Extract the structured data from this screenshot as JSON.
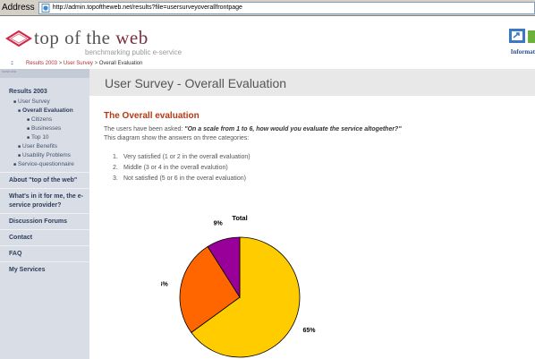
{
  "address_bar": {
    "label": "Address",
    "url": "http://admin.topoftheweb.net/results?file=usersurveyoverallfrontpage"
  },
  "header": {
    "logo_title_a": "top of the ",
    "logo_title_b": "web",
    "logo_subtitle": "benchmarking public e-service",
    "partner_label": "Informat"
  },
  "breadcrumb": {
    "items": [
      "Results 2003",
      "User Survey"
    ],
    "separator": ">",
    "current": "Overall Evaluation"
  },
  "sidebar": {
    "top_strip": "www.vba",
    "section_title": "Results 2003",
    "tree": [
      {
        "label": "User Survey",
        "level": 1
      },
      {
        "label": "Overall Evaluation",
        "level": 2
      },
      {
        "label": "Citizens",
        "level": 3
      },
      {
        "label": "Businesses",
        "level": 3
      },
      {
        "label": "Top 10",
        "level": 3
      },
      {
        "label": "User Benefits",
        "level": 1
      },
      {
        "label": "Usability Problems",
        "level": 1
      },
      {
        "label": "Service-questionnaire",
        "level": 1
      }
    ],
    "links": [
      "About \"top of the web\"",
      "What's in it for me, the e-service provider?",
      "Discussion Forums",
      "Contact",
      "FAQ",
      "My Services"
    ]
  },
  "main": {
    "page_title": "User Survey - Overall Evaluation",
    "section_title": "The Overall evaluation",
    "question_lead": "The users have been asked: ",
    "question": "\"On a scale from 1 to 6, how would you evaluate the service altogether?\"",
    "categories_intro": "This diagram show the answers on three categories:",
    "categories": [
      "Very satisfied (1 or 2 in the overall evaluation)",
      "Middle (3 or 4 in the overall evalution)",
      "Not satisfied (5 or 6 in the overal evaluation)"
    ]
  },
  "chart_data": {
    "type": "pie",
    "title": "Total",
    "slices": [
      {
        "label": "65%",
        "value": 65,
        "color": "#ffcc00"
      },
      {
        "label": "26%",
        "value": 26,
        "color": "#ff6600"
      },
      {
        "label": "9%",
        "value": 9,
        "color": "#990099"
      }
    ]
  },
  "colors": {
    "sidebar_bg": "#d9dde6",
    "title_bar_bg": "#e8e8e8",
    "accent_red": "#b33a14"
  }
}
